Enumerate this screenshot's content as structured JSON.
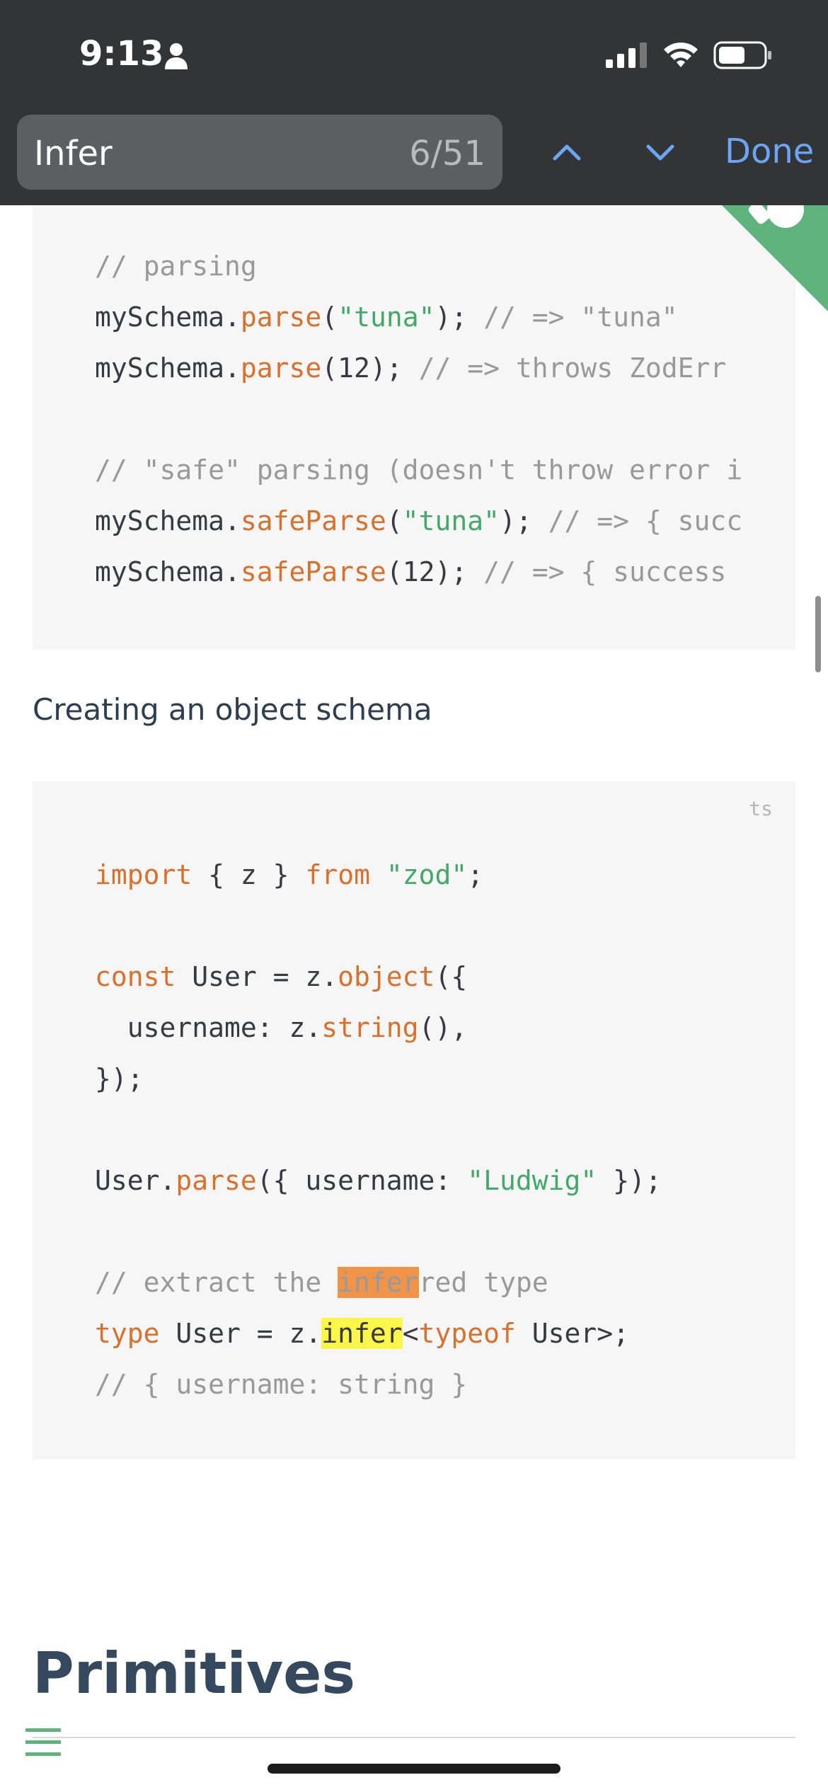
{
  "status_bar": {
    "time": "9:13"
  },
  "find_bar": {
    "query": "Infer",
    "match_count": "6/51",
    "done_label": "Done"
  },
  "code_block_1": {
    "lines": [
      {
        "parts": [
          {
            "t": "// parsing",
            "c": "c"
          }
        ]
      },
      {
        "parts": [
          {
            "t": "mySchema.",
            "c": ""
          },
          {
            "t": "parse",
            "c": "f"
          },
          {
            "t": "(",
            "c": ""
          },
          {
            "t": "\"tuna\"",
            "c": "s"
          },
          {
            "t": "); ",
            "c": ""
          },
          {
            "t": "// => \"tuna\"",
            "c": "c"
          }
        ]
      },
      {
        "parts": [
          {
            "t": "mySchema.",
            "c": ""
          },
          {
            "t": "parse",
            "c": "f"
          },
          {
            "t": "(12); ",
            "c": ""
          },
          {
            "t": "// => throws ZodErr",
            "c": "c"
          }
        ]
      },
      {
        "parts": [
          {
            "t": "",
            "c": ""
          }
        ]
      },
      {
        "parts": [
          {
            "t": "// \"safe\" parsing (doesn't throw error i",
            "c": "c"
          }
        ]
      },
      {
        "parts": [
          {
            "t": "mySchema.",
            "c": ""
          },
          {
            "t": "safeParse",
            "c": "f"
          },
          {
            "t": "(",
            "c": ""
          },
          {
            "t": "\"tuna\"",
            "c": "s"
          },
          {
            "t": "); ",
            "c": ""
          },
          {
            "t": "// => { succ",
            "c": "c"
          }
        ]
      },
      {
        "parts": [
          {
            "t": "mySchema.",
            "c": ""
          },
          {
            "t": "safeParse",
            "c": "f"
          },
          {
            "t": "(12); ",
            "c": ""
          },
          {
            "t": "// => { success",
            "c": "c"
          }
        ]
      }
    ]
  },
  "subheading": "Creating an object schema",
  "code_block_2": {
    "lang": "ts",
    "lines": [
      {
        "parts": [
          {
            "t": "import",
            "c": "k"
          },
          {
            "t": " { z } ",
            "c": ""
          },
          {
            "t": "from",
            "c": "k"
          },
          {
            "t": " ",
            "c": ""
          },
          {
            "t": "\"zod\"",
            "c": "s"
          },
          {
            "t": ";",
            "c": ""
          }
        ]
      },
      {
        "parts": [
          {
            "t": "",
            "c": ""
          }
        ]
      },
      {
        "parts": [
          {
            "t": "const",
            "c": "k"
          },
          {
            "t": " User = z.",
            "c": ""
          },
          {
            "t": "object",
            "c": "f"
          },
          {
            "t": "({",
            "c": ""
          }
        ]
      },
      {
        "parts": [
          {
            "t": "  username: z.",
            "c": ""
          },
          {
            "t": "string",
            "c": "f"
          },
          {
            "t": "(),",
            "c": ""
          }
        ]
      },
      {
        "parts": [
          {
            "t": "});",
            "c": ""
          }
        ]
      },
      {
        "parts": [
          {
            "t": "",
            "c": ""
          }
        ]
      },
      {
        "parts": [
          {
            "t": "User.",
            "c": ""
          },
          {
            "t": "parse",
            "c": "f"
          },
          {
            "t": "({ username: ",
            "c": ""
          },
          {
            "t": "\"Ludwig\"",
            "c": "s"
          },
          {
            "t": " });",
            "c": ""
          }
        ]
      },
      {
        "parts": [
          {
            "t": "",
            "c": ""
          }
        ]
      },
      {
        "parts": [
          {
            "t": "// extract the ",
            "c": "c"
          },
          {
            "t": "infer",
            "c": "hl-current"
          },
          {
            "t": "red type",
            "c": "c"
          }
        ]
      },
      {
        "parts": [
          {
            "t": "type",
            "c": "k"
          },
          {
            "t": " User = z.",
            "c": ""
          },
          {
            "t": "infer",
            "c": "hl-other"
          },
          {
            "t": "<",
            "c": ""
          },
          {
            "t": "typeof",
            "c": "k"
          },
          {
            "t": " User>;",
            "c": ""
          }
        ]
      },
      {
        "parts": [
          {
            "t": "// { username: string }",
            "c": "c"
          }
        ]
      }
    ]
  },
  "section_title": "Primitives",
  "colors": {
    "accent_blue": "#6ba5f5",
    "current_match": "#f0944a",
    "other_match": "#fcf54a",
    "keyword": "#d9702b",
    "string": "#42a968",
    "badge_green": "#5fb47d"
  }
}
